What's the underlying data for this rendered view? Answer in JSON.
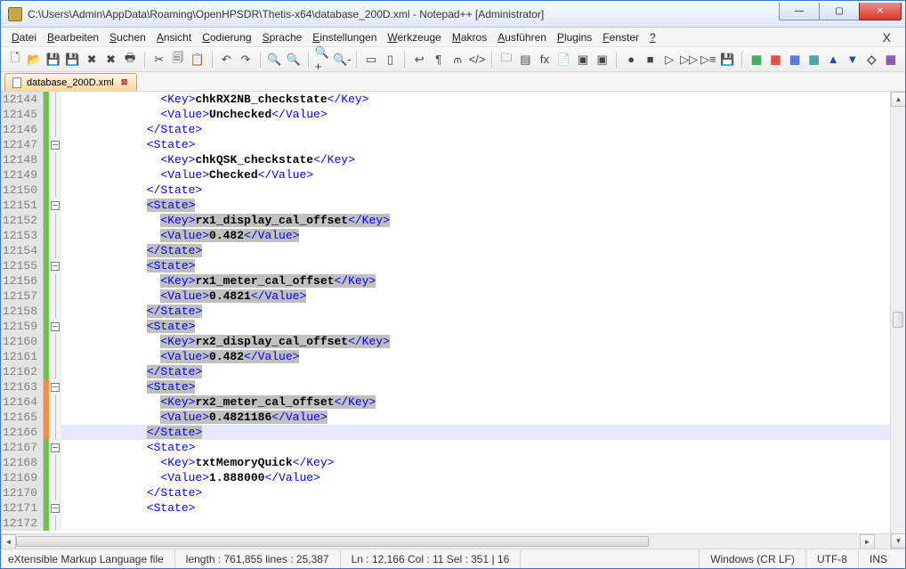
{
  "window": {
    "title": "C:\\Users\\Admin\\AppData\\Roaming\\OpenHPSDR\\Thetis-x64\\database_200D.xml - Notepad++ [Administrator]",
    "minimize": "—",
    "maximize": "▢",
    "close": "✕"
  },
  "menu": {
    "items": [
      "Datei",
      "Bearbeiten",
      "Suchen",
      "Ansicht",
      "Codierung",
      "Sprache",
      "Einstellungen",
      "Werkzeuge",
      "Makros",
      "Ausführen",
      "Plugins",
      "Fenster",
      "?"
    ],
    "underlines": [
      0,
      0,
      0,
      0,
      0,
      0,
      0,
      0,
      0,
      0,
      0,
      0,
      0
    ],
    "closeDoc": "X"
  },
  "toolbar": {
    "groups": [
      [
        "new",
        "open",
        "save",
        "save-all",
        "close",
        "close-all",
        "print"
      ],
      [
        "cut",
        "copy",
        "paste"
      ],
      [
        "undo",
        "redo"
      ],
      [
        "find",
        "replace"
      ],
      [
        "zoom-in",
        "zoom-out"
      ],
      [
        "sync-v",
        "sync-h"
      ],
      [
        "wrap",
        "all-chars",
        "indent-guide",
        "lang"
      ],
      [
        "folder",
        "doc-map",
        "func",
        "f",
        "monitor1",
        "monitor2"
      ],
      [
        "record",
        "stop",
        "play",
        "play-ff",
        "play-multi",
        "save-macro"
      ],
      [
        "c1",
        "c2",
        "c3",
        "c4",
        "c5",
        "c6",
        "c7",
        "c8"
      ]
    ],
    "glyphs": {
      "new": "🗋",
      "open": "📂",
      "save": "💾",
      "save-all": "💾",
      "close": "✖",
      "close-all": "✖",
      "print": "🖶",
      "cut": "✂",
      "copy": "🗐",
      "paste": "📋",
      "undo": "↶",
      "redo": "↷",
      "find": "🔍",
      "replace": "🔍",
      "zoom-in": "🔍+",
      "zoom-out": "🔍-",
      "sync-v": "▭",
      "sync-h": "▯",
      "wrap": "↩",
      "all-chars": "¶",
      "indent-guide": "⫙",
      "lang": "</>",
      "folder": "🗀",
      "doc-map": "▤",
      "func": "fx",
      "f": "📄",
      "monitor1": "▣",
      "monitor2": "▣",
      "record": "●",
      "stop": "■",
      "play": "▷",
      "play-ff": "▷▷",
      "play-multi": "▷≡",
      "save-macro": "💾",
      "c1": "▦",
      "c2": "▦",
      "c3": "▦",
      "c4": "▦",
      "c5": "▲",
      "c6": "▼",
      "c7": "◇",
      "c8": "▦"
    }
  },
  "tab": {
    "label": "database_200D.xml"
  },
  "editor": {
    "startLine": 12144,
    "currentLine": 12166,
    "rows": [
      {
        "ln": 12144,
        "ch": "s",
        "fold": "line",
        "ind": 4,
        "seg": [
          [
            "tag",
            "<Key>"
          ],
          [
            "txt",
            "chkRX2NB_checkstate"
          ],
          [
            "tag",
            "</Key>"
          ]
        ]
      },
      {
        "ln": 12145,
        "ch": "s",
        "fold": "line",
        "ind": 4,
        "seg": [
          [
            "tag",
            "<Value>"
          ],
          [
            "txt",
            "Unchecked"
          ],
          [
            "tag",
            "</Value>"
          ]
        ]
      },
      {
        "ln": 12146,
        "ch": "s",
        "fold": "line",
        "ind": 3,
        "seg": [
          [
            "tag",
            "</State>"
          ]
        ]
      },
      {
        "ln": 12147,
        "ch": "s",
        "fold": "minus",
        "ind": 3,
        "seg": [
          [
            "tag",
            "<State>"
          ]
        ]
      },
      {
        "ln": 12148,
        "ch": "s",
        "fold": "line",
        "ind": 4,
        "seg": [
          [
            "tag",
            "<Key>"
          ],
          [
            "txt",
            "chkQSK_checkstate"
          ],
          [
            "tag",
            "</Key>"
          ]
        ]
      },
      {
        "ln": 12149,
        "ch": "s",
        "fold": "line",
        "ind": 4,
        "seg": [
          [
            "tag",
            "<Value>"
          ],
          [
            "txt",
            "Checked"
          ],
          [
            "tag",
            "</Value>"
          ]
        ]
      },
      {
        "ln": 12150,
        "ch": "s",
        "fold": "line",
        "ind": 3,
        "seg": [
          [
            "tag",
            "</State>"
          ]
        ]
      },
      {
        "ln": 12151,
        "ch": "s",
        "fold": "minus",
        "ind": 3,
        "hl": true,
        "seg": [
          [
            "tag",
            "<State>"
          ]
        ]
      },
      {
        "ln": 12152,
        "ch": "s",
        "fold": "line",
        "ind": 4,
        "hl": true,
        "seg": [
          [
            "tag",
            "<Key>"
          ],
          [
            "txt",
            "rx1_display_cal_offset"
          ],
          [
            "tag",
            "</Key>"
          ]
        ]
      },
      {
        "ln": 12153,
        "ch": "s",
        "fold": "line",
        "ind": 4,
        "hl": true,
        "seg": [
          [
            "tag",
            "<Value>"
          ],
          [
            "txt",
            "0.482"
          ],
          [
            "tag",
            "</Value>"
          ]
        ]
      },
      {
        "ln": 12154,
        "ch": "s",
        "fold": "line",
        "ind": 3,
        "hl": true,
        "seg": [
          [
            "tag",
            "</State>"
          ]
        ]
      },
      {
        "ln": 12155,
        "ch": "s",
        "fold": "minus",
        "ind": 3,
        "hl": true,
        "seg": [
          [
            "tag",
            "<State>"
          ]
        ]
      },
      {
        "ln": 12156,
        "ch": "s",
        "fold": "line",
        "ind": 4,
        "hl": true,
        "seg": [
          [
            "tag",
            "<Key>"
          ],
          [
            "txt",
            "rx1_meter_cal_offset"
          ],
          [
            "tag",
            "</Key>"
          ]
        ]
      },
      {
        "ln": 12157,
        "ch": "s",
        "fold": "line",
        "ind": 4,
        "hl": true,
        "seg": [
          [
            "tag",
            "<Value>"
          ],
          [
            "txt",
            "0.4821"
          ],
          [
            "tag",
            "</Value>"
          ]
        ]
      },
      {
        "ln": 12158,
        "ch": "s",
        "fold": "line",
        "ind": 3,
        "hl": true,
        "seg": [
          [
            "tag",
            "</State>"
          ]
        ]
      },
      {
        "ln": 12159,
        "ch": "s",
        "fold": "minus",
        "ind": 3,
        "hl": true,
        "seg": [
          [
            "tag",
            "<State>"
          ]
        ]
      },
      {
        "ln": 12160,
        "ch": "s",
        "fold": "line",
        "ind": 4,
        "hl": true,
        "seg": [
          [
            "tag",
            "<Key>"
          ],
          [
            "txt",
            "rx2_display_cal_offset"
          ],
          [
            "tag",
            "</Key>"
          ]
        ]
      },
      {
        "ln": 12161,
        "ch": "s",
        "fold": "line",
        "ind": 4,
        "hl": true,
        "seg": [
          [
            "tag",
            "<Value>"
          ],
          [
            "txt",
            "0.482"
          ],
          [
            "tag",
            "</Value>"
          ]
        ]
      },
      {
        "ln": 12162,
        "ch": "s",
        "fold": "line",
        "ind": 3,
        "hl": true,
        "seg": [
          [
            "tag",
            "</State>"
          ]
        ]
      },
      {
        "ln": 12163,
        "ch": "c",
        "fold": "minus",
        "ind": 3,
        "hl": true,
        "seg": [
          [
            "tag",
            "<State>"
          ]
        ]
      },
      {
        "ln": 12164,
        "ch": "c",
        "fold": "line",
        "ind": 4,
        "hl": true,
        "seg": [
          [
            "tag",
            "<Key>"
          ],
          [
            "txt",
            "rx2_meter_cal_offset"
          ],
          [
            "tag",
            "</Key>"
          ]
        ]
      },
      {
        "ln": 12165,
        "ch": "c",
        "fold": "line",
        "ind": 4,
        "hl": true,
        "seg": [
          [
            "tag",
            "<Value>"
          ],
          [
            "txt",
            "0.4821186"
          ],
          [
            "tag",
            "</Value>"
          ]
        ]
      },
      {
        "ln": 12166,
        "ch": "c",
        "fold": "line",
        "ind": 3,
        "hl": true,
        "seg": [
          [
            "tag",
            "</State>"
          ]
        ]
      },
      {
        "ln": 12167,
        "ch": "s",
        "fold": "minus",
        "ind": 3,
        "seg": [
          [
            "tag",
            "<State>"
          ]
        ]
      },
      {
        "ln": 12168,
        "ch": "s",
        "fold": "line",
        "ind": 4,
        "seg": [
          [
            "tag",
            "<Key>"
          ],
          [
            "txt",
            "txtMemoryQuick"
          ],
          [
            "tag",
            "</Key>"
          ]
        ]
      },
      {
        "ln": 12169,
        "ch": "s",
        "fold": "line",
        "ind": 4,
        "seg": [
          [
            "tag",
            "<Value>"
          ],
          [
            "txt",
            "1.888000"
          ],
          [
            "tag",
            "</Value>"
          ]
        ]
      },
      {
        "ln": 12170,
        "ch": "s",
        "fold": "line",
        "ind": 3,
        "seg": [
          [
            "tag",
            "</State>"
          ]
        ]
      },
      {
        "ln": 12171,
        "ch": "s",
        "fold": "minus",
        "ind": 3,
        "seg": [
          [
            "tag",
            "<State>"
          ]
        ]
      },
      {
        "ln": 12172,
        "ch": "s",
        "fold": "line",
        "ind": 4,
        "seg": [
          [
            "tag",
            ""
          ]
        ]
      }
    ]
  },
  "status": {
    "lang": "eXtensible Markup Language file",
    "length": "length : 761,855    lines : 25,387",
    "pos": "Ln : 12,166    Col : 11    Sel : 351 | 16",
    "eol": "Windows (CR LF)",
    "enc": "UTF-8",
    "ins": "INS"
  },
  "toolbarColors": [
    "#2fa84f",
    "#d94141",
    "#4a6fd1",
    "#36a0a0",
    "#1f4aa8",
    "#1f4aa8",
    "#3a3a3a",
    "#8a4aa8"
  ]
}
